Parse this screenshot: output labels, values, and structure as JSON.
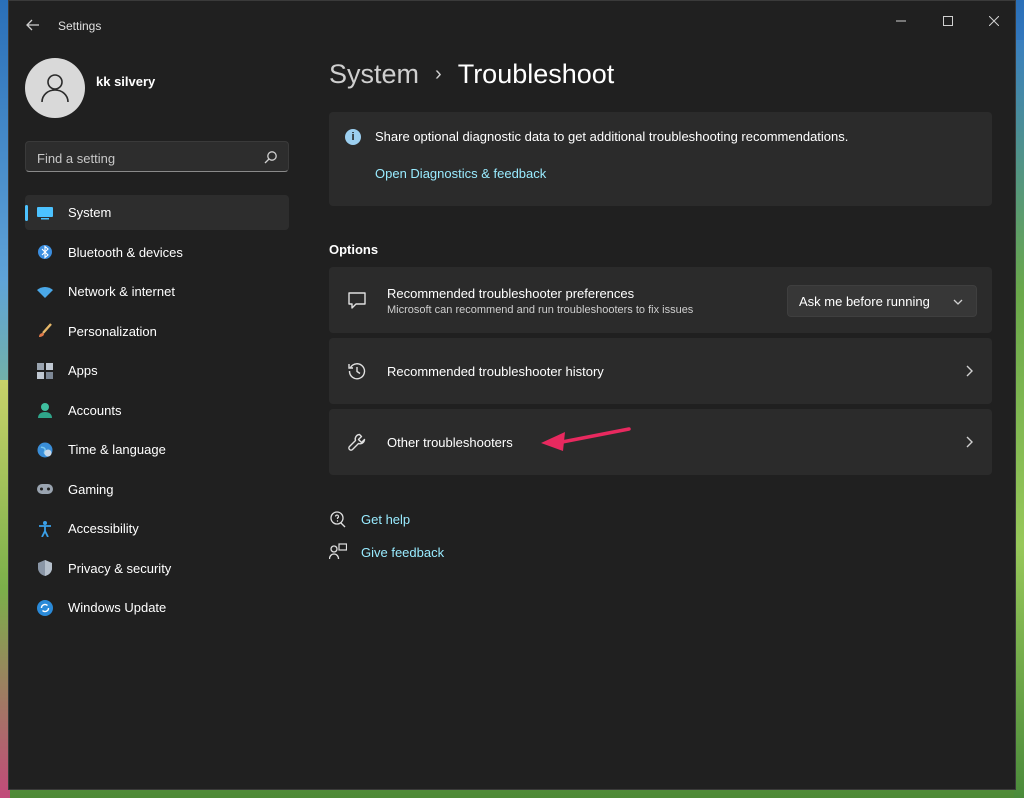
{
  "window": {
    "title": "Settings"
  },
  "profile": {
    "name": "kk silvery"
  },
  "search": {
    "placeholder": "Find a setting"
  },
  "sidebar": {
    "items": [
      {
        "label": "System",
        "icon": "system-icon",
        "active": true
      },
      {
        "label": "Bluetooth & devices",
        "icon": "bluetooth-icon"
      },
      {
        "label": "Network & internet",
        "icon": "wifi-icon"
      },
      {
        "label": "Personalization",
        "icon": "brush-icon"
      },
      {
        "label": "Apps",
        "icon": "apps-icon"
      },
      {
        "label": "Accounts",
        "icon": "account-icon"
      },
      {
        "label": "Time & language",
        "icon": "globe-icon"
      },
      {
        "label": "Gaming",
        "icon": "gamepad-icon"
      },
      {
        "label": "Accessibility",
        "icon": "accessibility-icon"
      },
      {
        "label": "Privacy & security",
        "icon": "shield-icon"
      },
      {
        "label": "Windows Update",
        "icon": "update-icon"
      }
    ]
  },
  "breadcrumb": {
    "parent": "System",
    "separator": "›",
    "current": "Troubleshoot"
  },
  "info": {
    "text": "Share optional diagnostic data to get additional troubleshooting recommendations.",
    "link": "Open Diagnostics & feedback"
  },
  "options": {
    "section_title": "Options",
    "preferences": {
      "title": "Recommended troubleshooter preferences",
      "subtitle": "Microsoft can recommend and run troubleshooters to fix issues",
      "dropdown_value": "Ask me before running"
    },
    "history": {
      "title": "Recommended troubleshooter history"
    },
    "other": {
      "title": "Other troubleshooters"
    }
  },
  "help": {
    "get_help": "Get help",
    "give_feedback": "Give feedback"
  },
  "colors": {
    "accent": "#4cc2ff",
    "link": "#99ebff",
    "annotation_arrow": "#e8295f",
    "window_bg": "#202020",
    "card_bg": "#2b2b2b"
  }
}
